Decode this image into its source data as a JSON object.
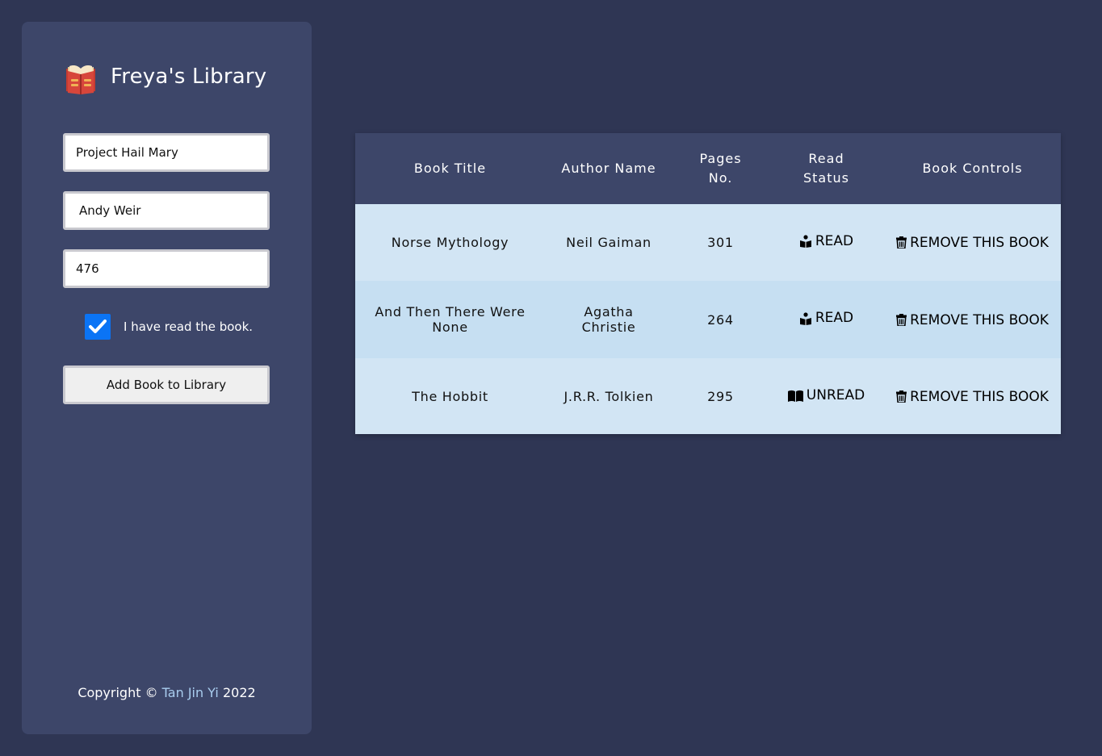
{
  "app": {
    "title": "Freya's Library",
    "brand_icon": "book-icon"
  },
  "form": {
    "title_value": "Project Hail Mary",
    "author_value": "Andy Weir",
    "pages_value": "476",
    "read_checked": true,
    "read_label": "I have read the book.",
    "submit_label": "Add Book to Library"
  },
  "footer": {
    "prefix": "Copyright © ",
    "author": "Tan Jin Yi",
    "year": " 2022"
  },
  "table": {
    "headers": {
      "title": "Book Title",
      "author": "Author Name",
      "pages": "Pages No.",
      "status": "Read Status",
      "controls": "Book Controls"
    },
    "rows": [
      {
        "title": "Norse Mythology",
        "author": "Neil Gaiman",
        "pages": "301",
        "status": "READ",
        "status_icon": "reading-person-icon",
        "control": "REMOVE THIS BOOK",
        "control_icon": "trash-icon"
      },
      {
        "title": "And Then There Were None",
        "author": "Agatha Christie",
        "pages": "264",
        "status": "READ",
        "status_icon": "reading-person-icon",
        "control": "REMOVE THIS BOOK",
        "control_icon": "trash-icon"
      },
      {
        "title": "The Hobbit",
        "author": "J.R.R. Tolkien",
        "pages": "295",
        "status": "UNREAD",
        "status_icon": "open-book-icon",
        "control": "REMOVE THIS BOOK",
        "control_icon": "trash-icon"
      }
    ]
  },
  "colors": {
    "page_bg": "#2f3654",
    "panel_bg": "#3d4669",
    "row_light": "#d2e5f4",
    "row_dark": "#c6dff2",
    "checkbox": "#0b74f5",
    "link": "#a9cdef"
  }
}
